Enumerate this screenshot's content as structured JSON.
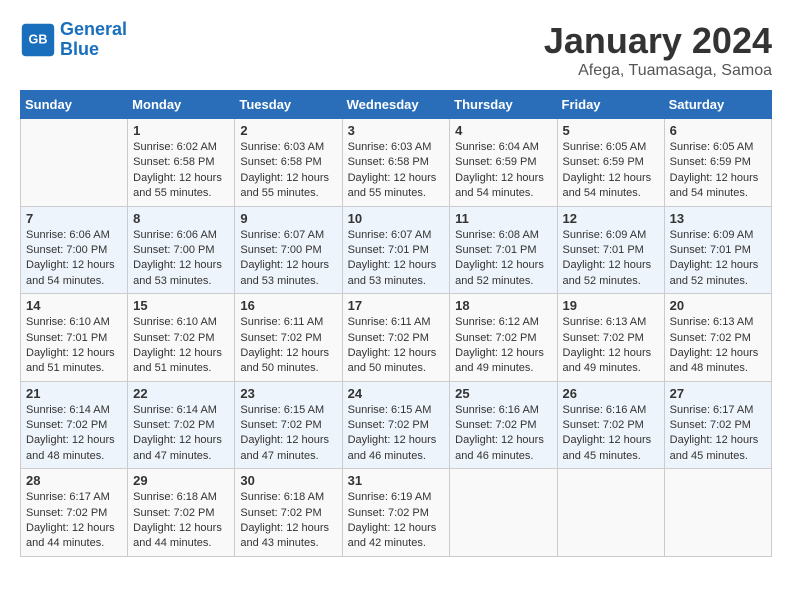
{
  "header": {
    "logo_line1": "General",
    "logo_line2": "Blue",
    "month": "January 2024",
    "location": "Afega, Tuamasaga, Samoa"
  },
  "weekdays": [
    "Sunday",
    "Monday",
    "Tuesday",
    "Wednesday",
    "Thursday",
    "Friday",
    "Saturday"
  ],
  "weeks": [
    [
      {
        "day": "",
        "sunrise": "",
        "sunset": "",
        "daylight": ""
      },
      {
        "day": "1",
        "sunrise": "6:02 AM",
        "sunset": "6:58 PM",
        "daylight": "12 hours and 55 minutes."
      },
      {
        "day": "2",
        "sunrise": "6:03 AM",
        "sunset": "6:58 PM",
        "daylight": "12 hours and 55 minutes."
      },
      {
        "day": "3",
        "sunrise": "6:03 AM",
        "sunset": "6:58 PM",
        "daylight": "12 hours and 55 minutes."
      },
      {
        "day": "4",
        "sunrise": "6:04 AM",
        "sunset": "6:59 PM",
        "daylight": "12 hours and 54 minutes."
      },
      {
        "day": "5",
        "sunrise": "6:05 AM",
        "sunset": "6:59 PM",
        "daylight": "12 hours and 54 minutes."
      },
      {
        "day": "6",
        "sunrise": "6:05 AM",
        "sunset": "6:59 PM",
        "daylight": "12 hours and 54 minutes."
      }
    ],
    [
      {
        "day": "7",
        "sunrise": "6:06 AM",
        "sunset": "7:00 PM",
        "daylight": "12 hours and 54 minutes."
      },
      {
        "day": "8",
        "sunrise": "6:06 AM",
        "sunset": "7:00 PM",
        "daylight": "12 hours and 53 minutes."
      },
      {
        "day": "9",
        "sunrise": "6:07 AM",
        "sunset": "7:00 PM",
        "daylight": "12 hours and 53 minutes."
      },
      {
        "day": "10",
        "sunrise": "6:07 AM",
        "sunset": "7:01 PM",
        "daylight": "12 hours and 53 minutes."
      },
      {
        "day": "11",
        "sunrise": "6:08 AM",
        "sunset": "7:01 PM",
        "daylight": "12 hours and 52 minutes."
      },
      {
        "day": "12",
        "sunrise": "6:09 AM",
        "sunset": "7:01 PM",
        "daylight": "12 hours and 52 minutes."
      },
      {
        "day": "13",
        "sunrise": "6:09 AM",
        "sunset": "7:01 PM",
        "daylight": "12 hours and 52 minutes."
      }
    ],
    [
      {
        "day": "14",
        "sunrise": "6:10 AM",
        "sunset": "7:01 PM",
        "daylight": "12 hours and 51 minutes."
      },
      {
        "day": "15",
        "sunrise": "6:10 AM",
        "sunset": "7:02 PM",
        "daylight": "12 hours and 51 minutes."
      },
      {
        "day": "16",
        "sunrise": "6:11 AM",
        "sunset": "7:02 PM",
        "daylight": "12 hours and 50 minutes."
      },
      {
        "day": "17",
        "sunrise": "6:11 AM",
        "sunset": "7:02 PM",
        "daylight": "12 hours and 50 minutes."
      },
      {
        "day": "18",
        "sunrise": "6:12 AM",
        "sunset": "7:02 PM",
        "daylight": "12 hours and 49 minutes."
      },
      {
        "day": "19",
        "sunrise": "6:13 AM",
        "sunset": "7:02 PM",
        "daylight": "12 hours and 49 minutes."
      },
      {
        "day": "20",
        "sunrise": "6:13 AM",
        "sunset": "7:02 PM",
        "daylight": "12 hours and 48 minutes."
      }
    ],
    [
      {
        "day": "21",
        "sunrise": "6:14 AM",
        "sunset": "7:02 PM",
        "daylight": "12 hours and 48 minutes."
      },
      {
        "day": "22",
        "sunrise": "6:14 AM",
        "sunset": "7:02 PM",
        "daylight": "12 hours and 47 minutes."
      },
      {
        "day": "23",
        "sunrise": "6:15 AM",
        "sunset": "7:02 PM",
        "daylight": "12 hours and 47 minutes."
      },
      {
        "day": "24",
        "sunrise": "6:15 AM",
        "sunset": "7:02 PM",
        "daylight": "12 hours and 46 minutes."
      },
      {
        "day": "25",
        "sunrise": "6:16 AM",
        "sunset": "7:02 PM",
        "daylight": "12 hours and 46 minutes."
      },
      {
        "day": "26",
        "sunrise": "6:16 AM",
        "sunset": "7:02 PM",
        "daylight": "12 hours and 45 minutes."
      },
      {
        "day": "27",
        "sunrise": "6:17 AM",
        "sunset": "7:02 PM",
        "daylight": "12 hours and 45 minutes."
      }
    ],
    [
      {
        "day": "28",
        "sunrise": "6:17 AM",
        "sunset": "7:02 PM",
        "daylight": "12 hours and 44 minutes."
      },
      {
        "day": "29",
        "sunrise": "6:18 AM",
        "sunset": "7:02 PM",
        "daylight": "12 hours and 44 minutes."
      },
      {
        "day": "30",
        "sunrise": "6:18 AM",
        "sunset": "7:02 PM",
        "daylight": "12 hours and 43 minutes."
      },
      {
        "day": "31",
        "sunrise": "6:19 AM",
        "sunset": "7:02 PM",
        "daylight": "12 hours and 42 minutes."
      },
      {
        "day": "",
        "sunrise": "",
        "sunset": "",
        "daylight": ""
      },
      {
        "day": "",
        "sunrise": "",
        "sunset": "",
        "daylight": ""
      },
      {
        "day": "",
        "sunrise": "",
        "sunset": "",
        "daylight": ""
      }
    ]
  ]
}
